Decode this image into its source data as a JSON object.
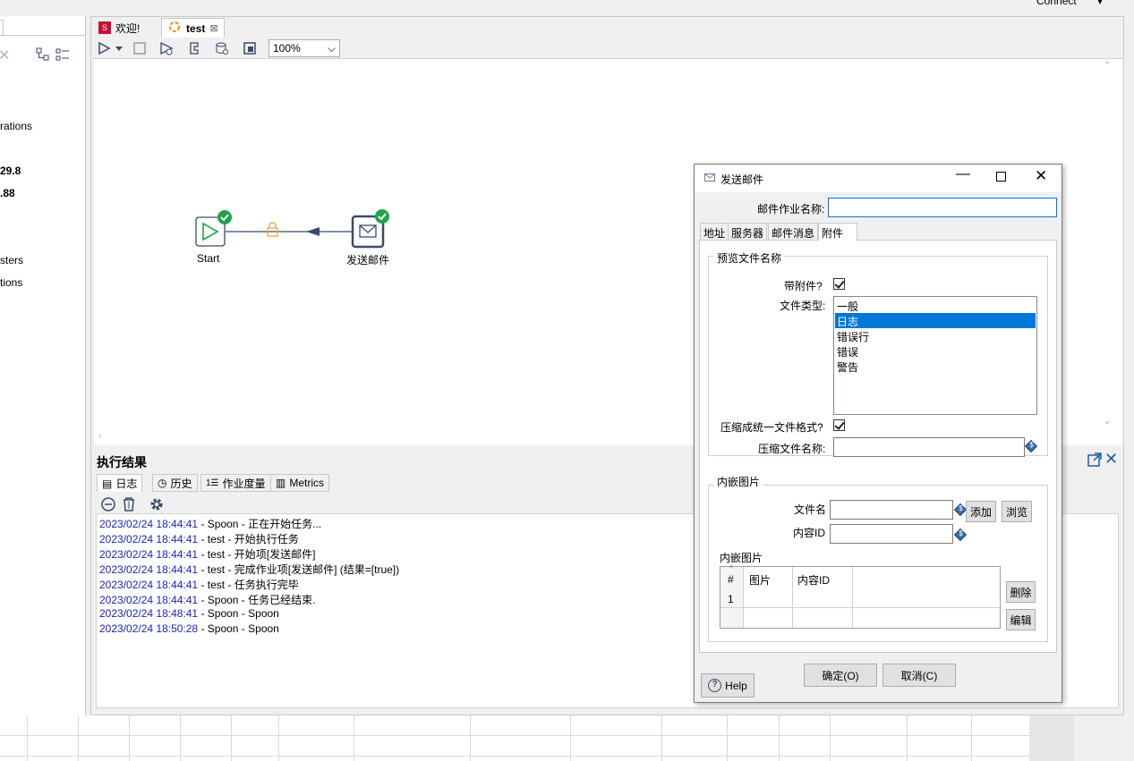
{
  "top": {
    "connect": "Connect"
  },
  "left_panel": {
    "texts": [
      "rations",
      "29.8",
      ".88",
      "sters",
      "tions"
    ]
  },
  "editor": {
    "tabs": [
      {
        "label": "欢迎!"
      },
      {
        "label": "test"
      }
    ],
    "zoom": "100%",
    "canvas": {
      "nodes": [
        {
          "label": "Start"
        },
        {
          "label": "发送邮件"
        }
      ]
    }
  },
  "results": {
    "title": "执行结果",
    "tabs": [
      "日志",
      "历史",
      "作业度量",
      "Metrics"
    ],
    "log": [
      {
        "ts": "2023/02/24 18:44:41",
        "msg": " - Spoon - 正在开始任务..."
      },
      {
        "ts": "2023/02/24 18:44:41",
        "msg": " - test - 开始执行任务"
      },
      {
        "ts": "2023/02/24 18:44:41",
        "msg": " - test - 开始项[发送邮件]"
      },
      {
        "ts": "2023/02/24 18:44:41",
        "msg": " - test - 完成作业项[发送邮件] (结果=[true])"
      },
      {
        "ts": "2023/02/24 18:44:41",
        "msg": " - test - 任务执行完毕"
      },
      {
        "ts": "2023/02/24 18:44:41",
        "msg": " - Spoon - 任务已经结束."
      },
      {
        "ts": "2023/02/24 18:48:41",
        "msg": " - Spoon - Spoon"
      },
      {
        "ts": "2023/02/24 18:50:28",
        "msg": " - Spoon - Spoon"
      }
    ]
  },
  "dialog": {
    "title": "发送邮件",
    "job_name_label": "邮件作业名称:",
    "job_name_value": "",
    "tabs": [
      "地址",
      "服务器",
      "邮件消息",
      "附件"
    ],
    "preview_group": "预览文件名称",
    "with_attachment_label": "带附件?",
    "file_type_label": "文件类型:",
    "file_types": [
      "一般",
      "日志",
      "错误行",
      "错误",
      "警告"
    ],
    "selected_file_type": "日志",
    "zip_label": "压缩成统一文件格式?",
    "zip_name_label": "压缩文件名称:",
    "embedded_group": "内嵌图片",
    "filename_label": "文件名",
    "content_id_label": "内容ID",
    "add_button": "添加",
    "browse_button": "浏览",
    "images_label": "内嵌图片",
    "table_headers": [
      "#",
      "图片",
      "内容ID"
    ],
    "table_rows": [
      [
        "1",
        "",
        ""
      ]
    ],
    "delete_button": "删除",
    "edit_button": "编辑",
    "help_button": "Help",
    "ok_button": "确定(O)",
    "cancel_button": "取消(C)"
  },
  "colors": {
    "accent_blue": "#0078d7",
    "log_timestamp": "#1a23c2",
    "success_green": "#1fa34a"
  }
}
